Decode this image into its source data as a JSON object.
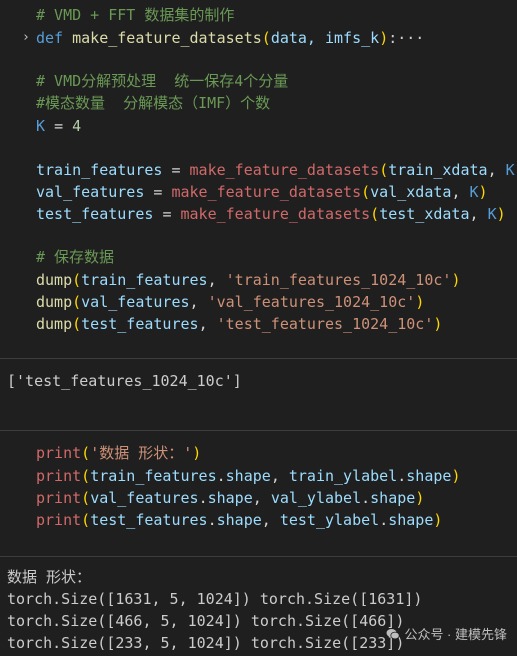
{
  "cell1": {
    "lines": {
      "l1_comment": "# VMD + FFT 数据集的制作",
      "l2_def": "def",
      "l2_fn": "make_feature_datasets",
      "l2_args": "data, imfs_k",
      "l2_tail": ":···",
      "l4_comment": "# VMD分解预处理  统一保存4个分量",
      "l5_comment": "#模态数量  分解模态（IMF）个数",
      "l6_var": "K",
      "l6_val": "4",
      "l8_var": "train_features",
      "l8_fn": "make_feature_datasets",
      "l8_arg1": "train_xdata",
      "l8_arg2": "K",
      "l9_var": "val_features",
      "l9_fn": "make_feature_datasets",
      "l9_arg1": "val_xdata",
      "l9_arg2": "K",
      "l10_var": "test_features",
      "l10_fn": "make_feature_datasets",
      "l10_arg1": "test_xdata",
      "l10_arg2": "K",
      "l12_comment": "# 保存数据",
      "l13_fn": "dump",
      "l13_var": "train_features",
      "l13_str": "'train_features_1024_10c'",
      "l14_fn": "dump",
      "l14_var": "val_features",
      "l14_str": "'val_features_1024_10c'",
      "l15_fn": "dump",
      "l15_var": "test_features",
      "l15_str": "'test_features_1024_10c'"
    }
  },
  "output1": {
    "text": "['test_features_1024_10c']"
  },
  "cell2": {
    "print": "print",
    "l1_str": "'数据 形状：'",
    "l2_a": "train_features",
    "l2_b": "train_ylabel",
    "l3_a": "val_features",
    "l3_b": "val_ylabel",
    "l4_a": "test_features",
    "l4_b": "test_ylabel",
    "attr": "shape"
  },
  "output2": {
    "lines": [
      "数据 形状：",
      "torch.Size([1631, 5, 1024]) torch.Size([1631])",
      "torch.Size([466, 5, 1024]) torch.Size([466])",
      "torch.Size([233, 5, 1024]) torch.Size([233])"
    ]
  },
  "watermark": {
    "text": "公众号 · 建模先锋",
    "icon": "wechat-icon"
  }
}
